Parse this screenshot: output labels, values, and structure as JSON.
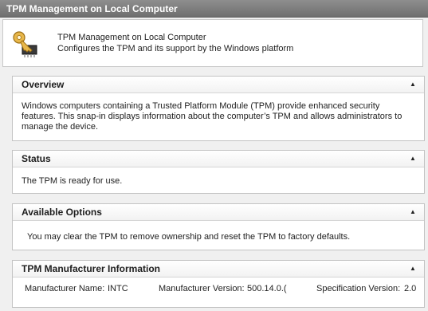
{
  "window": {
    "title": "TPM Management on Local Computer"
  },
  "header": {
    "icon": "key-chip-icon",
    "title": "TPM Management on Local Computer",
    "description": "Configures the TPM and its support by the Windows platform"
  },
  "sections": {
    "overview": {
      "title": "Overview",
      "text": "Windows computers containing a Trusted Platform Module (TPM) provide enhanced security features. This snap-in displays information about the computer’s TPM and allows administrators to manage the device."
    },
    "status": {
      "title": "Status",
      "text": "The TPM is ready for use."
    },
    "options": {
      "title": "Available Options",
      "text": "You may clear the TPM to remove ownership and reset the TPM to factory defaults."
    },
    "manufacturer": {
      "title": "TPM Manufacturer Information",
      "name_label": "Manufacturer Name:",
      "name_value": "INTC",
      "version_label": "Manufacturer Version:",
      "version_value": "500.14.0.(",
      "spec_label": "Specification Version:",
      "spec_value": "2.0"
    }
  },
  "collapse_glyph": "▲"
}
